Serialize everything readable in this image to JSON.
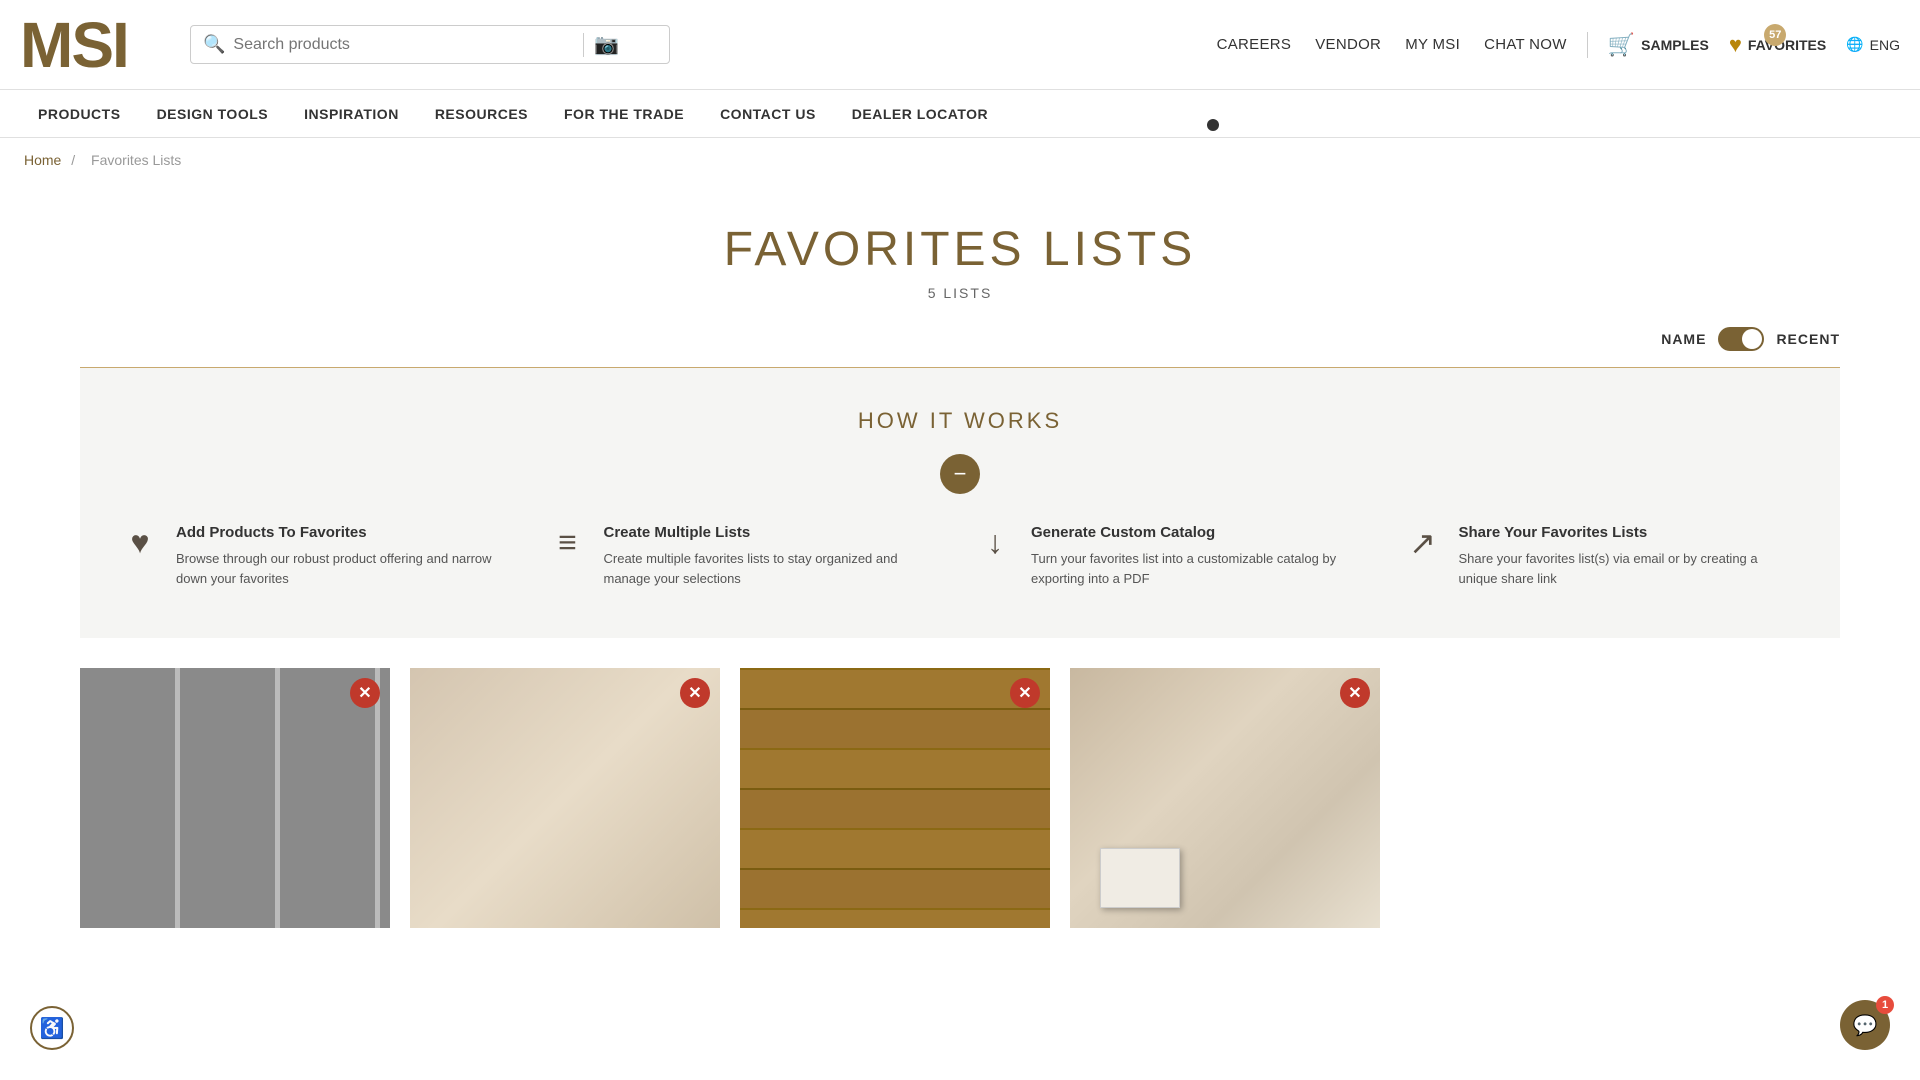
{
  "site": {
    "logo": "MSI",
    "language": "ENG"
  },
  "header": {
    "search_placeholder": "Search products",
    "nav_links": [
      {
        "label": "CAREERS",
        "id": "careers"
      },
      {
        "label": "VENDOR",
        "id": "vendor"
      },
      {
        "label": "MY MSI",
        "id": "my-msi"
      },
      {
        "label": "CHAT NOW",
        "id": "chat-now"
      }
    ],
    "samples_label": "SAMPLES",
    "favorites_label": "FAVORITES",
    "favorites_count": "57"
  },
  "main_nav": [
    {
      "label": "PRODUCTS",
      "id": "products"
    },
    {
      "label": "DESIGN TOOLS",
      "id": "design-tools"
    },
    {
      "label": "INSPIRATION",
      "id": "inspiration"
    },
    {
      "label": "RESOURCES",
      "id": "resources"
    },
    {
      "label": "FOR THE TRADE",
      "id": "for-the-trade"
    },
    {
      "label": "CONTACT US",
      "id": "contact-us"
    },
    {
      "label": "DEALER LOCATOR",
      "id": "dealer-locator"
    }
  ],
  "breadcrumb": {
    "home": "Home",
    "current": "Favorites Lists"
  },
  "page": {
    "title": "FAVORITES LISTS",
    "count": "5 LISTS"
  },
  "sort": {
    "name_label": "NAME",
    "recent_label": "RECENT"
  },
  "how_it_works": {
    "title": "HOW IT WORKS",
    "collapse_icon": "−",
    "features": [
      {
        "icon": "♥",
        "title": "Add Products To Favorites",
        "description": "Browse through our robust product offering and narrow down your favorites"
      },
      {
        "icon": "≡",
        "title": "Create Multiple Lists",
        "description": "Create multiple favorites lists to stay organized and manage your selections"
      },
      {
        "icon": "↓",
        "title": "Generate Custom Catalog",
        "description": "Turn your favorites list into a customizable catalog by exporting into a PDF"
      },
      {
        "icon": "↗",
        "title": "Share Your Favorites Lists",
        "description": "Share your favorites list(s) via email or by creating a unique share link"
      }
    ]
  },
  "product_cards": [
    {
      "id": 1,
      "style": "tile-gray"
    },
    {
      "id": 2,
      "style": "tile-beige"
    },
    {
      "id": 3,
      "style": "tile-wood"
    },
    {
      "id": 4,
      "style": "tile-light"
    }
  ],
  "chat": {
    "badge": "1"
  },
  "accessibility_label": "♿"
}
